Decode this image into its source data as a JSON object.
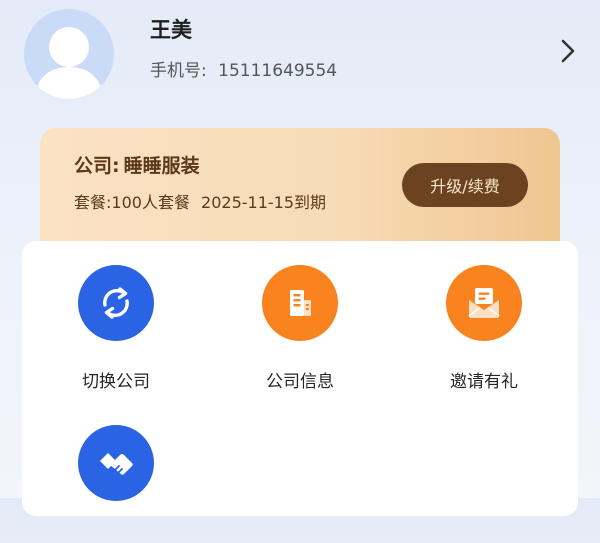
{
  "profile": {
    "name": "王美",
    "phone_label": "手机号:",
    "phone_number": "15111649554"
  },
  "company": {
    "name_label": "公司:",
    "name": "睡睡服装",
    "plan_label": "套餐:",
    "plan": "100人套餐",
    "expiry": "2025-11-15到期",
    "upgrade_label": "升级/续费"
  },
  "menu": {
    "items": [
      {
        "label": "切换公司",
        "icon": "switch-arrows-icon",
        "color": "#2a63e4"
      },
      {
        "label": "公司信息",
        "icon": "building-icon",
        "color": "#f9831f"
      },
      {
        "label": "邀请有礼",
        "icon": "envelope-icon",
        "color": "#f9831f"
      },
      {
        "label": "",
        "icon": "handshake-icon",
        "color": "#2a63e4"
      }
    ]
  },
  "colors": {
    "accent_blue": "#2a63e4",
    "accent_orange": "#f9831f",
    "card_brown": "#6b4320"
  }
}
